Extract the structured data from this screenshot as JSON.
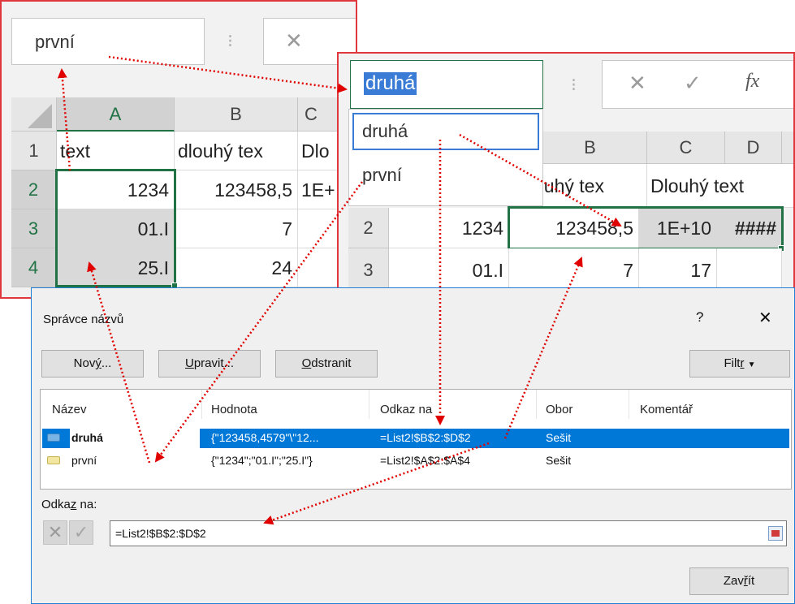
{
  "window1": {
    "name_box_value": "první",
    "columns": [
      "A",
      "B",
      "C"
    ],
    "rows": [
      {
        "num": "1",
        "a": "text",
        "b": "dlouhý tex",
        "c": "Dlo"
      },
      {
        "num": "2",
        "a": "1234",
        "b": "123458,5",
        "c": "1E+"
      },
      {
        "num": "3",
        "a": "01.I",
        "b": "7",
        "c": ""
      },
      {
        "num": "4",
        "a": "25.I",
        "b": "24",
        "c": ""
      }
    ]
  },
  "window2": {
    "name_box_value": "druhá",
    "fx_label": "fx",
    "dropdown_items": [
      "druhá",
      "první"
    ],
    "columns": [
      "B",
      "C",
      "D"
    ],
    "row1_partial": {
      "b": "ouhý tex",
      "c": "Dlouhý text"
    },
    "row2": {
      "num": "2",
      "a": "1234",
      "b": "123458,5",
      "c": "1E+10",
      "d": "####"
    },
    "row3": {
      "num": "3",
      "a": "01.I",
      "b": "7",
      "c": "17"
    }
  },
  "dialog": {
    "title": "Správce názvů",
    "help_label": "?",
    "close_label": "✕",
    "buttons": {
      "new_pre": "Nov",
      "new_u": "ý",
      "new_post": "...",
      "edit_u": "U",
      "edit_post": "pravit...",
      "delete_u": "O",
      "delete_post": "dstranit",
      "filter_pre": "Filt",
      "filter_u": "r",
      "close_pre": "Zav",
      "close_u": "ř",
      "close_post": "ít"
    },
    "columns": [
      "Název",
      "Hodnota",
      "Odkaz na",
      "Obor",
      "Komentář"
    ],
    "rows": [
      {
        "name": "druhá",
        "value": "{\"123458,4579\"\\\"12...",
        "ref": "=List2!$B$2:$D$2",
        "scope": "Sešit",
        "comment": "",
        "selected": true
      },
      {
        "name": "první",
        "value": "{\"1234\";\"01.I\";\"25.I\"}",
        "ref": "=List2!$A$2:$A$4",
        "scope": "Sešit",
        "comment": "",
        "selected": false
      }
    ],
    "ref_label_pre": "Odka",
    "ref_label_u": "z",
    "ref_label_post": " na:",
    "ref_value": "=List2!$B$2:$D$2"
  },
  "colors": {
    "excel_green": "#217346",
    "frame_red": "#e0363d",
    "arrow_red": "#e00000",
    "selection_blue": "#0078d7"
  }
}
